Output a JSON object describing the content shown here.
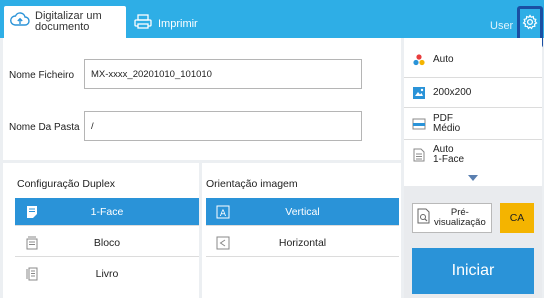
{
  "header": {
    "scan_tab": "Digitalizar um documento",
    "print_tab": "Imprimir",
    "user_label": "User",
    "icons": {
      "scan": "cloud-upload-icon",
      "print": "printer-icon",
      "settings": "gear-icon"
    }
  },
  "form": {
    "filename_label": "Nome Ficheiro",
    "filename_value": "MX-xxxx_20201010_101010",
    "folder_label": "Nome Da Pasta",
    "folder_value": "/"
  },
  "duplex": {
    "title": "Configuração Duplex",
    "options": [
      {
        "label": "1-Face",
        "selected": true,
        "icon": "single-side-page-icon"
      },
      {
        "label": "Bloco",
        "selected": false,
        "icon": "tablet-binding-icon"
      },
      {
        "label": "Livro",
        "selected": false,
        "icon": "book-binding-icon"
      }
    ]
  },
  "orientation": {
    "title": "Orientação imagem",
    "options": [
      {
        "label": "Vertical",
        "selected": true,
        "icon": "portrait-icon"
      },
      {
        "label": "Horizontal",
        "selected": false,
        "icon": "landscape-icon"
      }
    ]
  },
  "settings_panel": {
    "items": [
      {
        "label": "Auto",
        "icon": "color-mode-icon"
      },
      {
        "label": "200x200",
        "icon": "resolution-icon"
      },
      {
        "label": "PDF\nMédio",
        "icon": "file-format-icon"
      },
      {
        "label": "Auto\n1-Face",
        "icon": "original-size-icon"
      }
    ]
  },
  "actions": {
    "preview_label": "Pré-\nvisualização",
    "ca_label": "CA",
    "start_label": "Iniciar"
  },
  "colors": {
    "header_blue": "#2eaee6",
    "selected_blue": "#2a93d8",
    "ca_yellow": "#f4b400",
    "highlight_border": "#1a4fa3"
  }
}
